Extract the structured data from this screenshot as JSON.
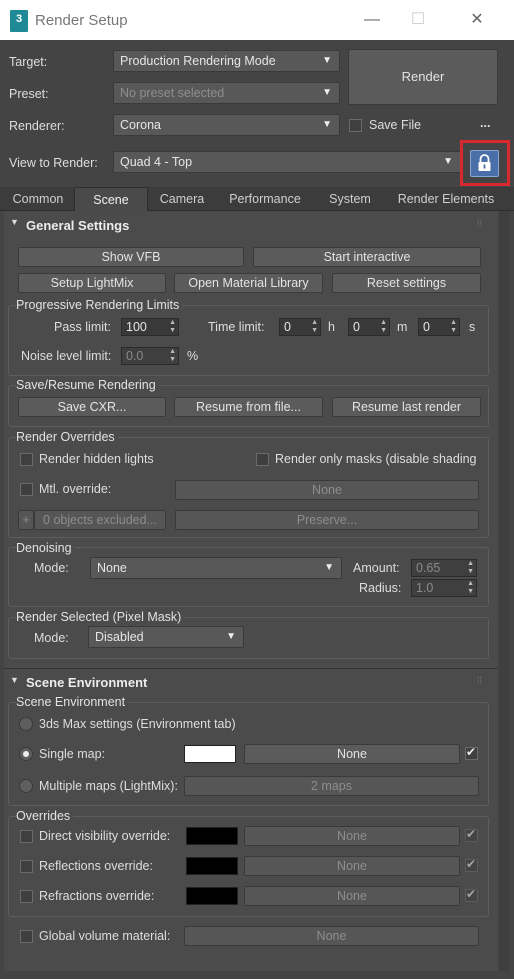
{
  "window": {
    "app_icon": "3",
    "title": "Render Setup",
    "minimize": "—",
    "maximize": "☐",
    "close": "✕"
  },
  "header": {
    "target_label": "Target:",
    "target_value": "Production Rendering Mode",
    "preset_label": "Preset:",
    "preset_value": "No preset selected",
    "renderer_label": "Renderer:",
    "renderer_value": "Corona",
    "save_file_label": "Save File",
    "more": "...",
    "view_label": "View to Render:",
    "view_value": "Quad 4 - Top",
    "render_button": "Render"
  },
  "tabs": [
    "Common",
    "Scene",
    "Camera",
    "Performance",
    "System",
    "Render Elements"
  ],
  "active_tab": "Scene",
  "general": {
    "title": "General Settings",
    "show_vfb": "Show VFB",
    "start_interactive": "Start interactive",
    "setup_lightmix": "Setup LightMix",
    "open_material_library": "Open Material Library",
    "reset_settings": "Reset settings",
    "progressive": {
      "title": "Progressive Rendering Limits",
      "pass_limit_label": "Pass limit:",
      "pass_limit": "100",
      "time_limit_label": "Time limit:",
      "h": "0",
      "h_unit": "h",
      "m": "0",
      "m_unit": "m",
      "s": "0",
      "s_unit": "s",
      "noise_label": "Noise level limit:",
      "noise": "0.0",
      "noise_unit": "%"
    },
    "save_resume": {
      "title": "Save/Resume Rendering",
      "save_cxr": "Save CXR...",
      "resume_file": "Resume from file...",
      "resume_last": "Resume last render"
    },
    "overrides": {
      "title": "Render Overrides",
      "hidden_lights": "Render hidden lights",
      "only_masks": "Render only masks (disable shading",
      "mtl_override": "Mtl. override:",
      "mtl_none": "None",
      "plus": "+",
      "excluded": "0 objects excluded...",
      "preserve": "Preserve..."
    },
    "denoising": {
      "title": "Denoising",
      "mode_label": "Mode:",
      "mode_value": "None",
      "amount_label": "Amount:",
      "amount": "0.65",
      "radius_label": "Radius:",
      "radius": "1.0"
    },
    "render_selected": {
      "title": "Render Selected (Pixel Mask)",
      "mode_label": "Mode:",
      "mode_value": "Disabled"
    }
  },
  "scene_env": {
    "title": "Scene Environment",
    "group_title": "Scene Environment",
    "max_settings": "3ds Max settings (Environment tab)",
    "single_map": "Single map:",
    "single_map_button": "None",
    "multiple_maps": "Multiple maps (LightMix):",
    "multiple_maps_button": "2 maps",
    "overrides": {
      "title": "Overrides",
      "direct": "Direct visibility override:",
      "reflections": "Reflections override:",
      "refractions": "Refractions override:",
      "none": "None"
    },
    "global_volume": "Global volume material:",
    "global_volume_button": "None"
  },
  "colors": {
    "accent_lock": "#4a6ea8",
    "highlight": "#d9282e"
  }
}
